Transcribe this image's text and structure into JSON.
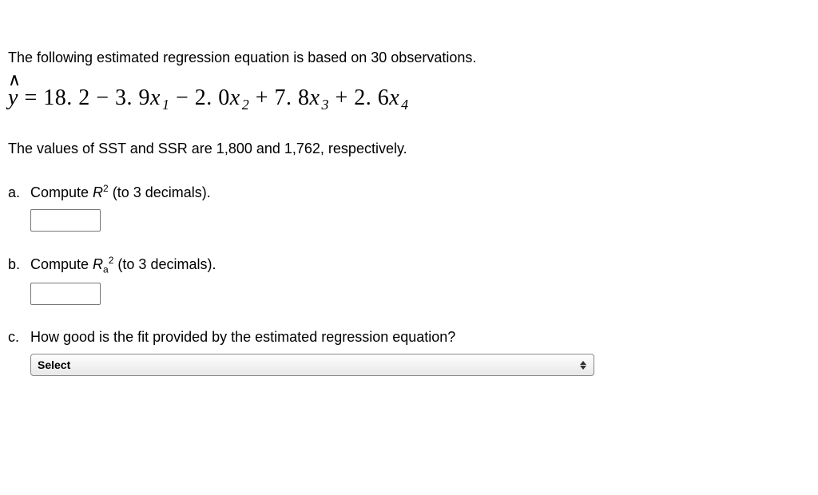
{
  "intro": "The following estimated regression equation is based on 30 observations.",
  "equation": {
    "lhs_sym": "y",
    "caret": "∧",
    "eq": " = ",
    "c0": "18. 2",
    "op1": " − ",
    "c1": "3. 9",
    "x": "x",
    "s1": "1",
    "op2": " − ",
    "c2": "2. 0",
    "s2": "2",
    "op3": " + ",
    "c3": "7. 8",
    "s3": "3",
    "op4": " + ",
    "c4": "2. 6",
    "s4": "4"
  },
  "sst_line": "The values of SST and SSR are 1,800 and 1,762, respectively.",
  "qa": {
    "letter": "a.",
    "pre": "Compute ",
    "sym": "R",
    "exp": "2",
    "post": " (to 3 decimals)."
  },
  "qb": {
    "letter": "b.",
    "pre": "Compute ",
    "sym": "R",
    "sub": "a",
    "exp": "2",
    "post": " (to 3 decimals)."
  },
  "qc": {
    "letter": "c.",
    "text": "How good is the fit provided by the estimated regression equation?"
  },
  "select_placeholder": "Select"
}
